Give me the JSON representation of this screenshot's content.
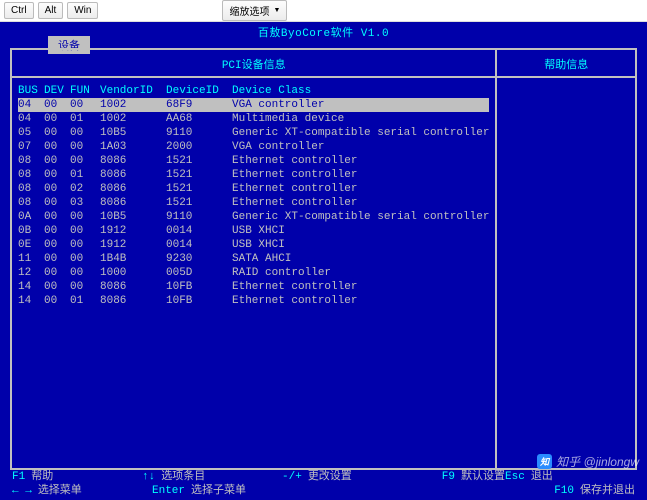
{
  "toolbar": {
    "ctrl": "Ctrl",
    "alt": "Alt",
    "win": "Win",
    "zoom_label": "缩放选项"
  },
  "app": {
    "title": "百敖ByoCore软件 V1.0"
  },
  "tab": {
    "label": "设备"
  },
  "panels": {
    "main_header": "PCI设备信息",
    "help_header": "帮助信息"
  },
  "headers": {
    "bus": "BUS",
    "dev": "DEV",
    "fun": "FUN",
    "vid": "VendorID",
    "did": "DeviceID",
    "cls": "Device Class"
  },
  "rows": [
    {
      "bus": "04",
      "dev": "00",
      "fun": "00",
      "vid": "1002",
      "did": "68F9",
      "cls": "VGA controller",
      "sel": true
    },
    {
      "bus": "04",
      "dev": "00",
      "fun": "01",
      "vid": "1002",
      "did": "AA68",
      "cls": "Multimedia device"
    },
    {
      "bus": "05",
      "dev": "00",
      "fun": "00",
      "vid": "10B5",
      "did": "9110",
      "cls": "Generic XT-compatible serial controller"
    },
    {
      "bus": "07",
      "dev": "00",
      "fun": "00",
      "vid": "1A03",
      "did": "2000",
      "cls": "VGA controller"
    },
    {
      "bus": "08",
      "dev": "00",
      "fun": "00",
      "vid": "8086",
      "did": "1521",
      "cls": "Ethernet controller"
    },
    {
      "bus": "08",
      "dev": "00",
      "fun": "01",
      "vid": "8086",
      "did": "1521",
      "cls": "Ethernet controller"
    },
    {
      "bus": "08",
      "dev": "00",
      "fun": "02",
      "vid": "8086",
      "did": "1521",
      "cls": "Ethernet controller"
    },
    {
      "bus": "08",
      "dev": "00",
      "fun": "03",
      "vid": "8086",
      "did": "1521",
      "cls": "Ethernet controller"
    },
    {
      "bus": "0A",
      "dev": "00",
      "fun": "00",
      "vid": "10B5",
      "did": "9110",
      "cls": "Generic XT-compatible serial controller"
    },
    {
      "bus": "0B",
      "dev": "00",
      "fun": "00",
      "vid": "1912",
      "did": "0014",
      "cls": "USB XHCI"
    },
    {
      "bus": "0E",
      "dev": "00",
      "fun": "00",
      "vid": "1912",
      "did": "0014",
      "cls": "USB XHCI"
    },
    {
      "bus": "11",
      "dev": "00",
      "fun": "00",
      "vid": "1B4B",
      "did": "9230",
      "cls": "SATA AHCI"
    },
    {
      "bus": "12",
      "dev": "00",
      "fun": "00",
      "vid": "1000",
      "did": "005D",
      "cls": "RAID controller"
    },
    {
      "bus": "14",
      "dev": "00",
      "fun": "00",
      "vid": "8086",
      "did": "10FB",
      "cls": "Ethernet controller"
    },
    {
      "bus": "14",
      "dev": "00",
      "fun": "01",
      "vid": "8086",
      "did": "10FB",
      "cls": "Ethernet controller"
    }
  ],
  "hints": {
    "f1_k": "F1",
    "f1_t": "帮助",
    "arrows_k": "↑↓",
    "arrows_t": "选项条目",
    "pm_k": "-/+",
    "pm_t": "更改设置",
    "f9_k": "F9",
    "f9_t": "默认设置",
    "esc_k": "Esc",
    "esc_t": "退出",
    "lr_k": "← →",
    "lr_t": "选择菜单",
    "enter_k": "Enter",
    "enter_t": "选择子菜单",
    "f10_k": "F10",
    "f10_t": "保存并退出"
  },
  "watermark": {
    "logo": "知",
    "text": "知乎 @jinlongw"
  }
}
